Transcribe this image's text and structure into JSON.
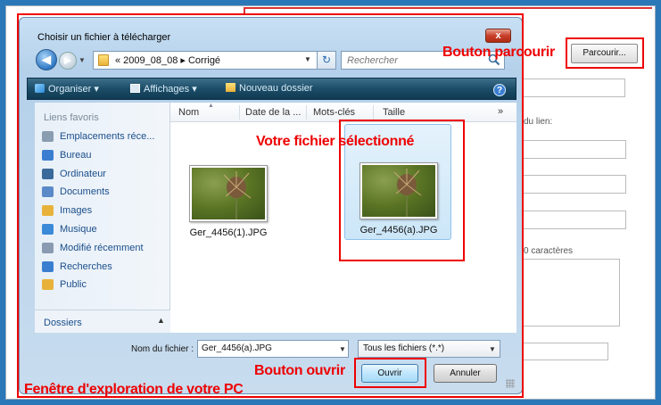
{
  "dialog": {
    "title": "Choisir un fichier à télécharger",
    "close_label": "x",
    "breadcrumb": "« 2009_08_08 ▸ Corrigé",
    "search_placeholder": "Rechercher",
    "toolbar": {
      "organize": "Organiser ▾",
      "views": "Affichages ▾",
      "new_folder": "Nouveau dossier",
      "help": "?"
    },
    "favorites_heading": "Liens favoris",
    "nav_items": [
      {
        "label": "Emplacements réce...",
        "icon": "recent-places-icon"
      },
      {
        "label": "Bureau",
        "icon": "desktop-icon"
      },
      {
        "label": "Ordinateur",
        "icon": "computer-icon"
      },
      {
        "label": "Documents",
        "icon": "documents-icon"
      },
      {
        "label": "Images",
        "icon": "pictures-icon"
      },
      {
        "label": "Musique",
        "icon": "music-icon"
      },
      {
        "label": "Modifié récemment",
        "icon": "recently-changed-icon"
      },
      {
        "label": "Recherches",
        "icon": "searches-icon"
      },
      {
        "label": "Public",
        "icon": "public-folder-icon"
      }
    ],
    "folders_label": "Dossiers",
    "columns": [
      "Nom",
      "Date de la ...",
      "Mots-clés",
      "Taille"
    ],
    "more_columns": "»",
    "files": [
      {
        "name": "Ger_4456(1).JPG",
        "selected": false
      },
      {
        "name": "Ger_4456(a).JPG",
        "selected": true
      }
    ],
    "filename_label": "Nom du fichier :",
    "filename_value": "Ger_4456(a).JPG",
    "filetype_value": "Tous les fichiers (*.*)",
    "open_button": "Ouvrir",
    "cancel_button": "Annuler"
  },
  "background_form": {
    "browse_button": "Parcourir...",
    "link_label_fragment": "du lien:",
    "chars_label_fragment": "0 caractères"
  },
  "annotations": {
    "browse": "Bouton parcourir",
    "selected_file": "Votre fichier sélectionné",
    "open": "Bouton ouvrir",
    "window": "Fenêtre d'exploration de votre PC"
  },
  "colors": {
    "annotation_red": "#e00000",
    "toolbar_dark": "#1c4d68",
    "selection_blue": "#cce6f8"
  }
}
